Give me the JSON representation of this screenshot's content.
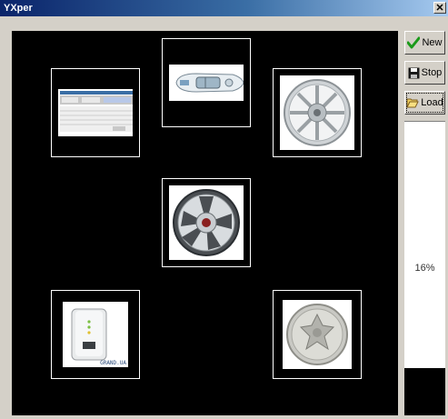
{
  "window": {
    "title": "YXper",
    "close_glyph": "✕"
  },
  "buttons": {
    "new_label": "New",
    "stop_label": "Stop",
    "load_label": "Load"
  },
  "progress": {
    "text": "16%",
    "fraction": 0.84
  },
  "colors": {
    "canvas": "#000000",
    "frame": "#ffffff",
    "check": "#1a9a1a"
  },
  "thumbnails": [
    {
      "name": "screenshot-thumbnail",
      "depicts": "software window screenshot"
    },
    {
      "name": "boat-thumbnail",
      "depicts": "motorboat top view"
    },
    {
      "name": "wheel-thumbnail-1",
      "depicts": "alloy wheel rim"
    },
    {
      "name": "wheel-thumbnail-2",
      "depicts": "alloy wheel rim"
    },
    {
      "name": "device-thumbnail",
      "depicts": "white device box",
      "caption": "GRAND.UA"
    },
    {
      "name": "coin-thumbnail",
      "depicts": "silver coin"
    }
  ]
}
